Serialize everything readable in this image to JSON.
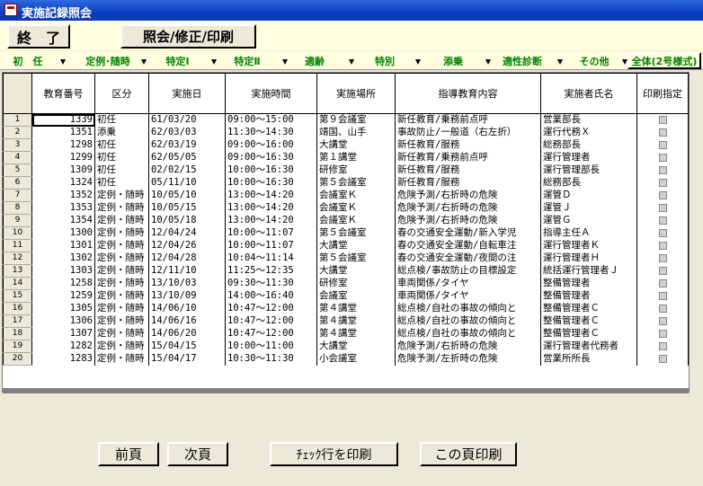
{
  "window": {
    "title": "実施記録照会"
  },
  "toolbar": {
    "exit_label": "終　了",
    "edit_label": "照会/修正/印刷"
  },
  "tabs": [
    {
      "label": "初　任"
    },
    {
      "label": "定例･随時"
    },
    {
      "label": "特定Ⅰ"
    },
    {
      "label": "特定Ⅱ"
    },
    {
      "label": "適齢"
    },
    {
      "label": "特別"
    },
    {
      "label": "添乗"
    },
    {
      "label": "適性診断"
    },
    {
      "label": "その他"
    },
    {
      "label": "全体(2号様式)"
    }
  ],
  "grid": {
    "headers": [
      "教育番号",
      "区分",
      "実施日",
      "実施時間",
      "実施場所",
      "指導教育内容",
      "実施者氏名",
      "印刷指定"
    ],
    "rows": [
      [
        "1",
        "1339",
        "初任",
        "61/03/20",
        "09:00～15:00",
        "第９会議室",
        "新任教育/乗務前点呼",
        "営業部長"
      ],
      [
        "2",
        "1351",
        "添乗",
        "62/03/03",
        "11:30～14:30",
        "靖国、山手",
        "事故防止/一般道（右左折）",
        "運行代務Ｘ"
      ],
      [
        "3",
        "1298",
        "初任",
        "62/03/19",
        "09:00～16:00",
        "大講堂",
        "新任教育/服務",
        "総務部長"
      ],
      [
        "4",
        "1299",
        "初任",
        "62/05/05",
        "09:00～16:30",
        "第１講堂",
        "新任教育/乗務前点呼",
        "運行管理者"
      ],
      [
        "5",
        "1309",
        "初任",
        "02/02/15",
        "10:00～16:30",
        "研修室",
        "新任教育/服務",
        "運行管理部長"
      ],
      [
        "6",
        "1324",
        "初任",
        "05/11/10",
        "10:00～16:30",
        "第５会議室",
        "新任教育/服務",
        "総務部長"
      ],
      [
        "7",
        "1352",
        "定例・随時",
        "10/05/10",
        "13:00～14:20",
        "会議室Ｋ",
        "危険予測/右折時の危険",
        "運管Ｄ"
      ],
      [
        "8",
        "1353",
        "定例・随時",
        "10/05/15",
        "13:00～14:20",
        "会議室Ｋ",
        "危険予測/右折時の危険",
        "運管Ｊ"
      ],
      [
        "9",
        "1354",
        "定例・随時",
        "10/05/18",
        "13:00～14:20",
        "会議室Ｋ",
        "危険予測/右折時の危険",
        "運管Ｇ"
      ],
      [
        "10",
        "1300",
        "定例・随時",
        "12/04/24",
        "10:00～11:07",
        "第５会議室",
        "春の交通安全運動/新入学児",
        "指導主任Ａ"
      ],
      [
        "11",
        "1301",
        "定例・随時",
        "12/04/26",
        "10:00～11:07",
        "大講堂",
        "春の交通安全運動/自転車注",
        "運行管理者Ｋ"
      ],
      [
        "12",
        "1302",
        "定例・随時",
        "12/04/28",
        "10:04～11:14",
        "第５会議室",
        "春の交通安全運動/夜間の注",
        "運行管理者Ｈ"
      ],
      [
        "13",
        "1303",
        "定例・随時",
        "12/11/10",
        "11:25～12:35",
        "大講堂",
        "総点検/事故防止の目標設定",
        "統括運行管理者Ｊ"
      ],
      [
        "14",
        "1258",
        "定例・随時",
        "13/10/03",
        "09:30～11:30",
        "研修室",
        "車両関係/タイヤ",
        "整備管理者"
      ],
      [
        "15",
        "1259",
        "定例・随時",
        "13/10/09",
        "14:00～16:40",
        "会議室",
        "車両関係/タイヤ",
        "整備管理者"
      ],
      [
        "16",
        "1305",
        "定例・随時",
        "14/06/10",
        "10:47～12:00",
        "第４講堂",
        "総点検/自社の事故の傾向と",
        "整備管理者Ｃ"
      ],
      [
        "17",
        "1306",
        "定例・随時",
        "14/06/16",
        "10:47～12:00",
        "第４講堂",
        "総点検/自社の事故の傾向と",
        "整備管理者Ｃ"
      ],
      [
        "18",
        "1307",
        "定例・随時",
        "14/06/20",
        "10:47～12:00",
        "第４講堂",
        "総点検/自社の事故の傾向と",
        "整備管理者Ｃ"
      ],
      [
        "19",
        "1282",
        "定例・随時",
        "15/04/15",
        "10:00～11:00",
        "大講堂",
        "危険予測/右折時の危険",
        "運行管理者代務者"
      ],
      [
        "20",
        "1283",
        "定例・随時",
        "15/04/17",
        "10:30～11:30",
        "小会議室",
        "危険予測/左折時の危険",
        "営業所所長"
      ]
    ]
  },
  "footer": {
    "prev_label": "前頁",
    "next_label": "次頁",
    "print_checked_label": "ﾁｪｯｸ行を印刷",
    "print_page_label": "この頁印刷"
  }
}
